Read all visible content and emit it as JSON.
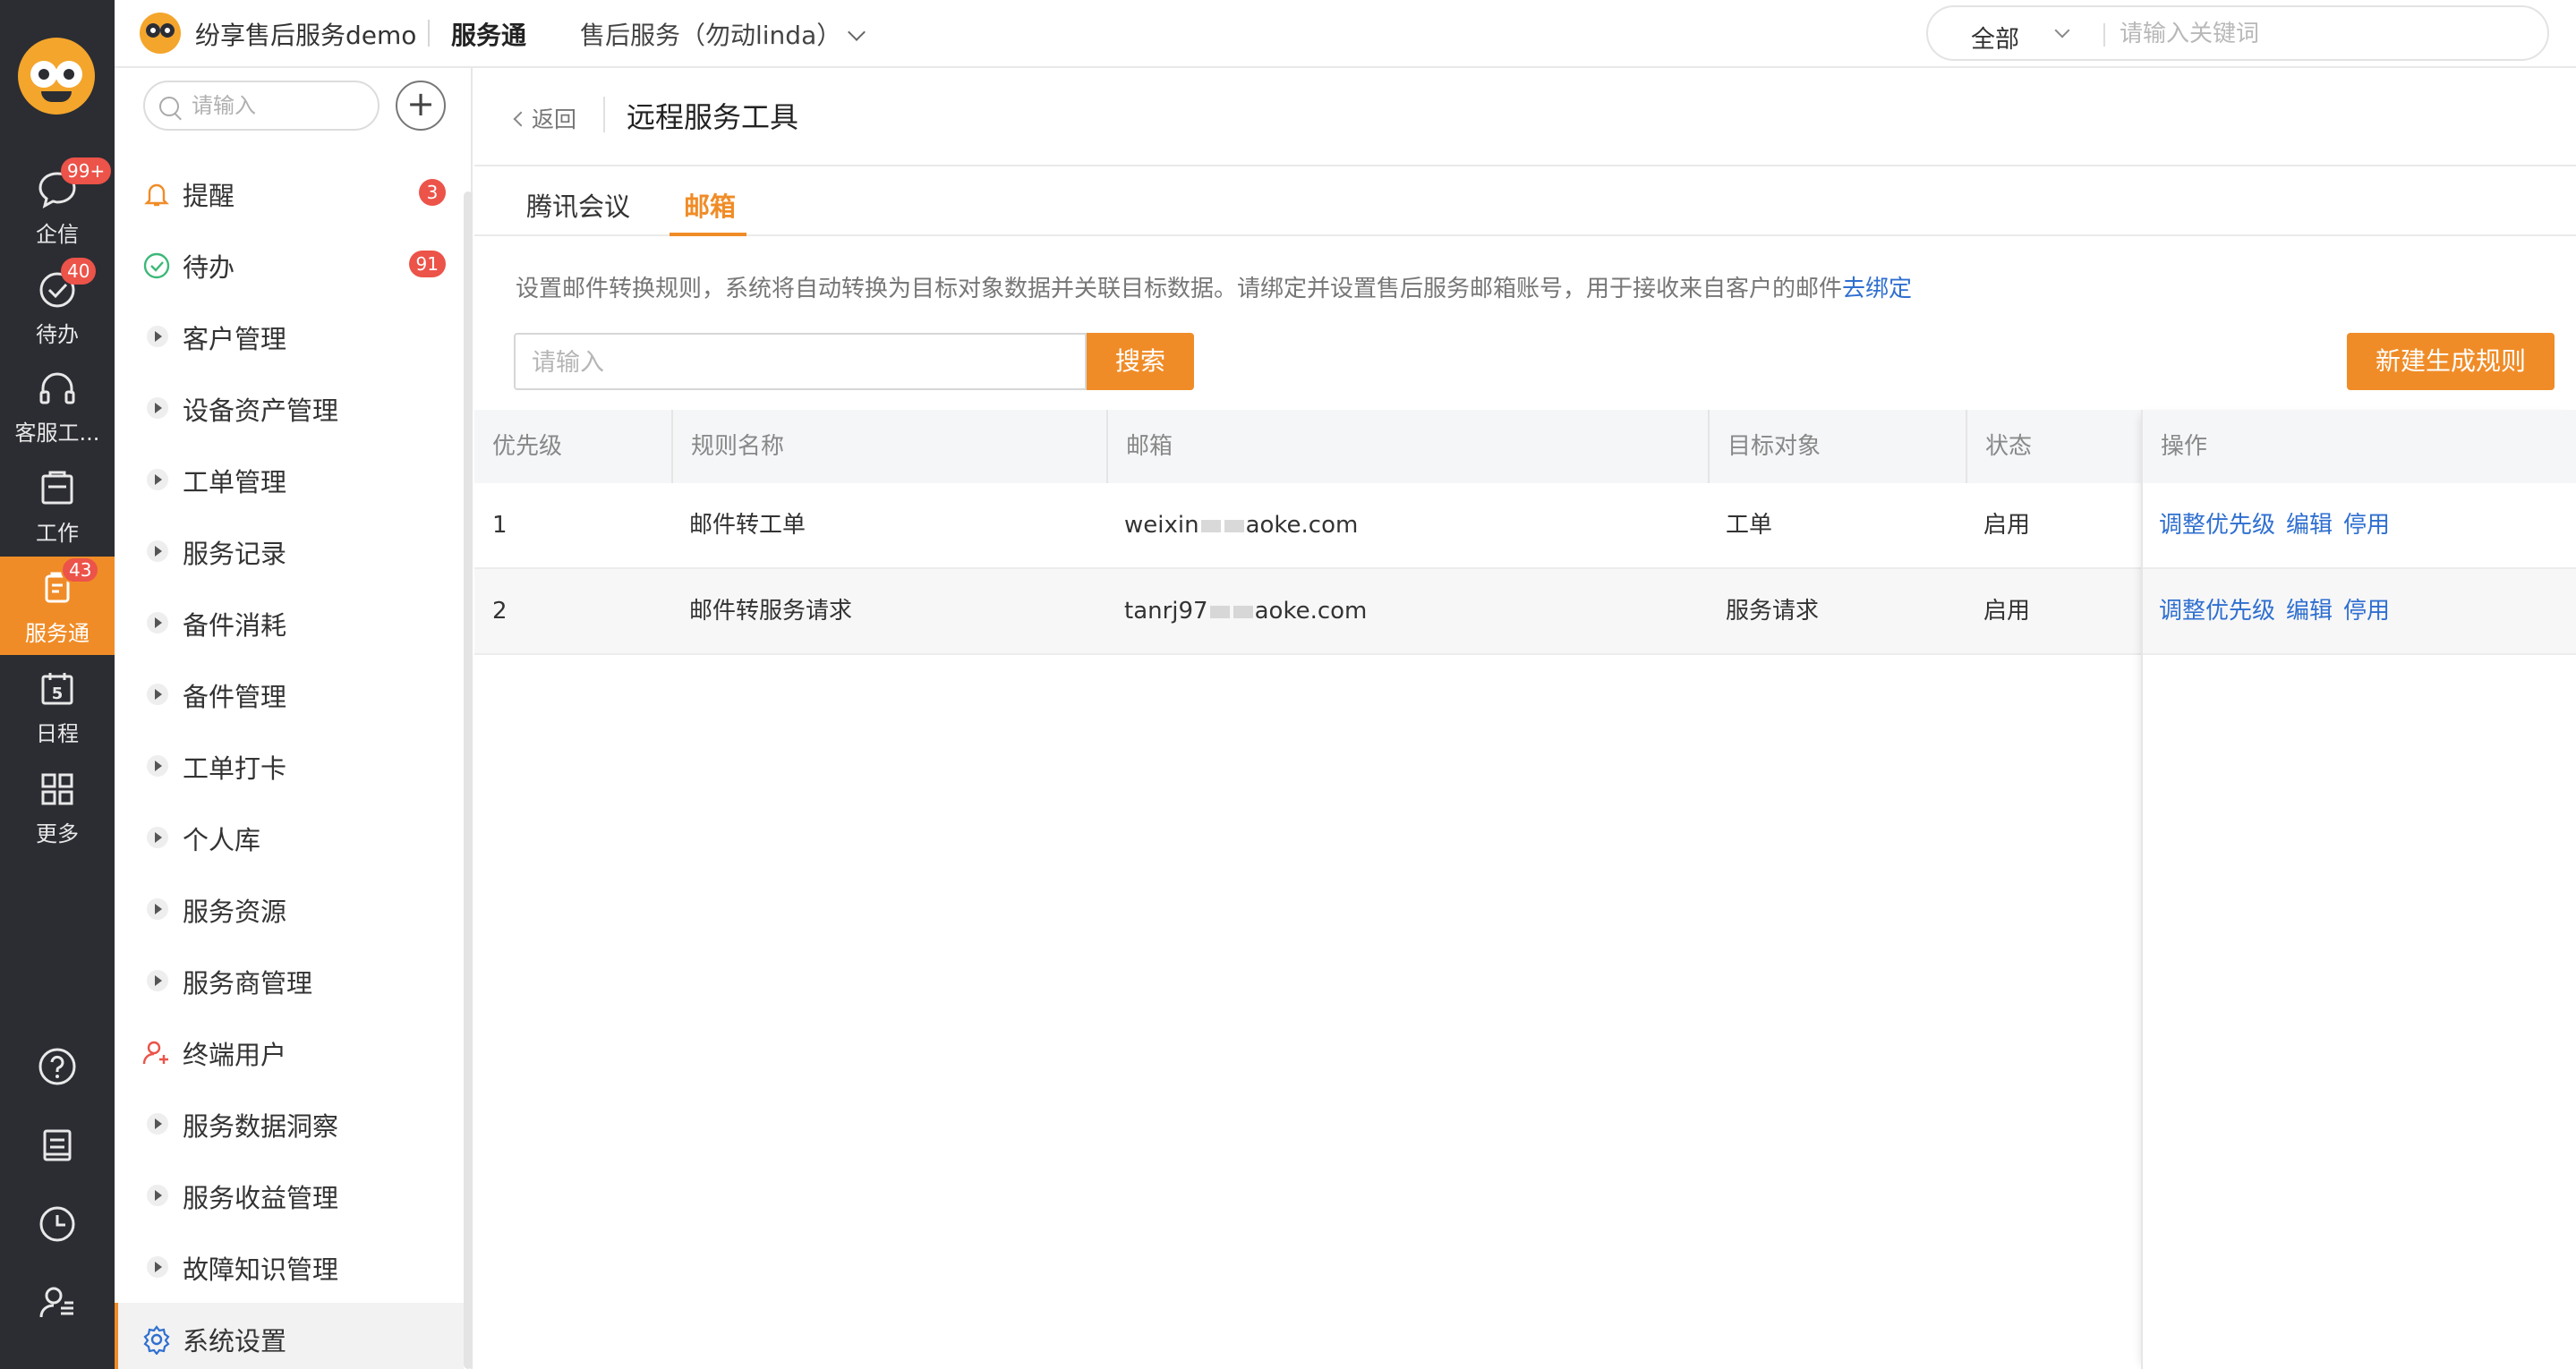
{
  "rail": {
    "items": [
      {
        "label": "企信",
        "badge": "99+",
        "icon": "chat-bubble-icon"
      },
      {
        "label": "待办",
        "badge": "40",
        "icon": "check-circle-icon"
      },
      {
        "label": "客服工...",
        "badge": "",
        "icon": "headset-icon"
      },
      {
        "label": "工作",
        "badge": "",
        "icon": "briefcase-icon"
      },
      {
        "label": "服务通",
        "badge": "43",
        "icon": "service-clipboard-icon"
      },
      {
        "label": "日程",
        "badge": "",
        "icon": "calendar-icon",
        "calendar_day": "5"
      },
      {
        "label": "更多",
        "badge": "",
        "icon": "grid-icon"
      }
    ],
    "bottom_icons": [
      "help-icon",
      "notebook-icon",
      "clock-icon",
      "user-list-icon"
    ]
  },
  "topbar": {
    "app_name": "纷享售后服务demo",
    "module": "服务通",
    "context": "售后服务（勿动linda）",
    "search_scope": "全部",
    "search_placeholder": "请输入关键词"
  },
  "menu": {
    "search_placeholder": "请输入",
    "add_label": "+",
    "items": [
      {
        "label": "提醒",
        "badge": "3",
        "icon": "bell-icon"
      },
      {
        "label": "待办",
        "badge": "91",
        "icon": "check-circle-icon"
      },
      {
        "label": "客户管理",
        "badge": ""
      },
      {
        "label": "设备资产管理",
        "badge": ""
      },
      {
        "label": "工单管理",
        "badge": ""
      },
      {
        "label": "服务记录",
        "badge": ""
      },
      {
        "label": "备件消耗",
        "badge": ""
      },
      {
        "label": "备件管理",
        "badge": ""
      },
      {
        "label": "工单打卡",
        "badge": ""
      },
      {
        "label": "个人库",
        "badge": ""
      },
      {
        "label": "服务资源",
        "badge": ""
      },
      {
        "label": "服务商管理",
        "badge": ""
      },
      {
        "label": "终端用户",
        "badge": "",
        "icon": "end-user-icon"
      },
      {
        "label": "服务数据洞察",
        "badge": ""
      },
      {
        "label": "服务收益管理",
        "badge": ""
      },
      {
        "label": "故障知识管理",
        "badge": ""
      },
      {
        "label": "系统设置",
        "badge": "",
        "icon": "gear-icon",
        "selected": true
      }
    ]
  },
  "page": {
    "back_label": "返回",
    "title": "远程服务工具",
    "tabs": [
      {
        "label": "腾讯会议",
        "active": false
      },
      {
        "label": "邮箱",
        "active": true
      }
    ],
    "description": "设置邮件转换规则，系统将自动转换为目标对象数据并关联目标数据。请绑定并设置售后服务邮箱账号，用于接收来自客户的邮件",
    "bind_link": "去绑定",
    "search_placeholder": "请输入",
    "search_button": "搜索",
    "new_rule_button": "新建生成规则"
  },
  "table": {
    "columns": [
      "优先级",
      "规则名称",
      "邮箱",
      "目标对象",
      "状态",
      "操作"
    ],
    "rows": [
      {
        "priority": "1",
        "name": "邮件转工单",
        "email_prefix": "weixin",
        "email_suffix": "aoke.com",
        "target": "工单",
        "status": "启用"
      },
      {
        "priority": "2",
        "name": "邮件转服务请求",
        "email_prefix": "tanrj97",
        "email_suffix": "aoke.com",
        "target": "服务请求",
        "status": "启用"
      }
    ],
    "actions": [
      "调整优先级",
      "编辑",
      "停用"
    ]
  },
  "colors": {
    "accent": "#f08c27",
    "link": "#2f6fd0",
    "rail_bg": "#2b2d33",
    "badge": "#ec5349"
  }
}
